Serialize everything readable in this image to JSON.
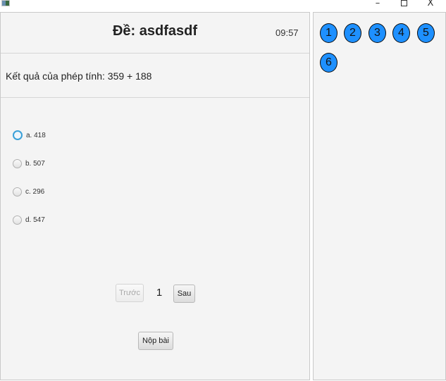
{
  "window": {
    "minimize_glyph": "–",
    "close_glyph": "X"
  },
  "exam": {
    "title": "Đề: asdfasdf",
    "timer": "09:57"
  },
  "question": {
    "text": "Kết quả của phép tính: 359 + 188",
    "options": [
      {
        "label": "a. 418"
      },
      {
        "label": "b. 507"
      },
      {
        "label": "c. 296"
      },
      {
        "label": "d. 547"
      }
    ]
  },
  "pagination": {
    "prev_label": "Trước",
    "current_page": "1",
    "next_label": "Sau"
  },
  "submit_label": "Nộp bài",
  "question_nav": {
    "items": [
      "1",
      "2",
      "3",
      "4",
      "5",
      "6"
    ],
    "color": "#1e90ff"
  }
}
